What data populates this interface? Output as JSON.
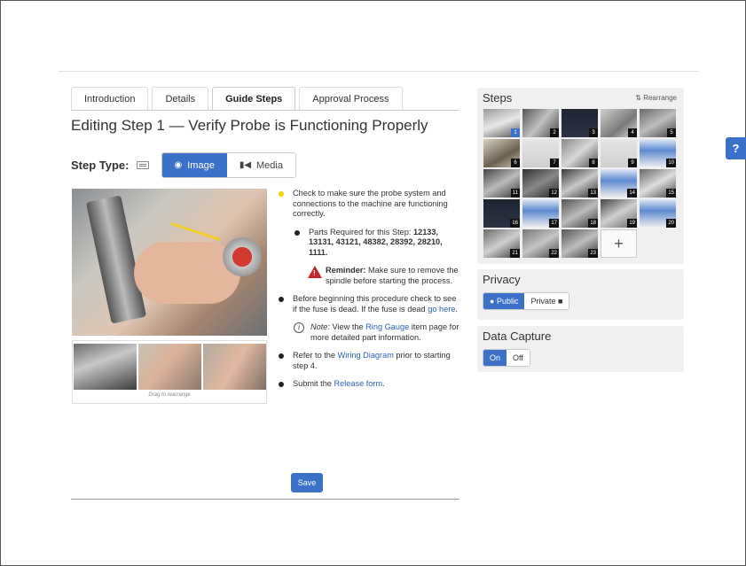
{
  "tabs": [
    {
      "label": "Introduction"
    },
    {
      "label": "Details"
    },
    {
      "label": "Guide Steps"
    },
    {
      "label": "Approval Process"
    }
  ],
  "page_title": "Editing Step 1 — Verify Probe is Functioning Properly",
  "step_type": {
    "label": "Step Type:",
    "options": [
      "Image",
      "Media"
    ],
    "selected": "Image"
  },
  "thumbnails": {
    "drag_note": "Drag to rearrange"
  },
  "bullets": {
    "b1": "Check to make sure the probe system and connections to the machine are functioning correctly.",
    "b2_prefix": "Parts Required for this Step: ",
    "b2_parts": "12133, 13131, 43121, 48382, 28392, 28210, 1111.",
    "b3_label": "Reminder:",
    "b3_text": " Make sure to remove the spindle before starting the process.",
    "b4_text": "Before beginning this procedure check to see if the fuse is dead. If the fuse is dead ",
    "b4_link": "go here",
    "b4_end": ".",
    "b5_label": "Note:",
    "b5_pre": " View the ",
    "b5_link": "Ring Gauge",
    "b5_post": " item page for more detailed part information.",
    "b6_pre": "Refer to the ",
    "b6_link": "Wiring Diagram",
    "b6_post": " prior to starting step 4.",
    "b7_pre": "Submit the ",
    "b7_link": "Release form",
    "b7_post": "."
  },
  "save_label": "Save",
  "steps_panel": {
    "title": "Steps",
    "rearrange_label": "Rearrange",
    "steps": [
      "1",
      "2",
      "3",
      "4",
      "5",
      "6",
      "7",
      "8",
      "9",
      "10",
      "11",
      "12",
      "13",
      "14",
      "15",
      "16",
      "17",
      "18",
      "19",
      "20",
      "21",
      "22",
      "23"
    ],
    "selected_step": "1",
    "add_label": "+"
  },
  "privacy": {
    "title": "Privacy",
    "options": [
      "Public",
      "Private"
    ],
    "selected": "Public"
  },
  "data_capture": {
    "title": "Data Capture",
    "options": [
      "On",
      "Off"
    ],
    "selected": "On"
  },
  "help_label": "?",
  "colors": {
    "accent": "#3b71c9",
    "link": "#2b62b8",
    "warning": "#c62828",
    "bullet_yellow": "#f2d200"
  }
}
